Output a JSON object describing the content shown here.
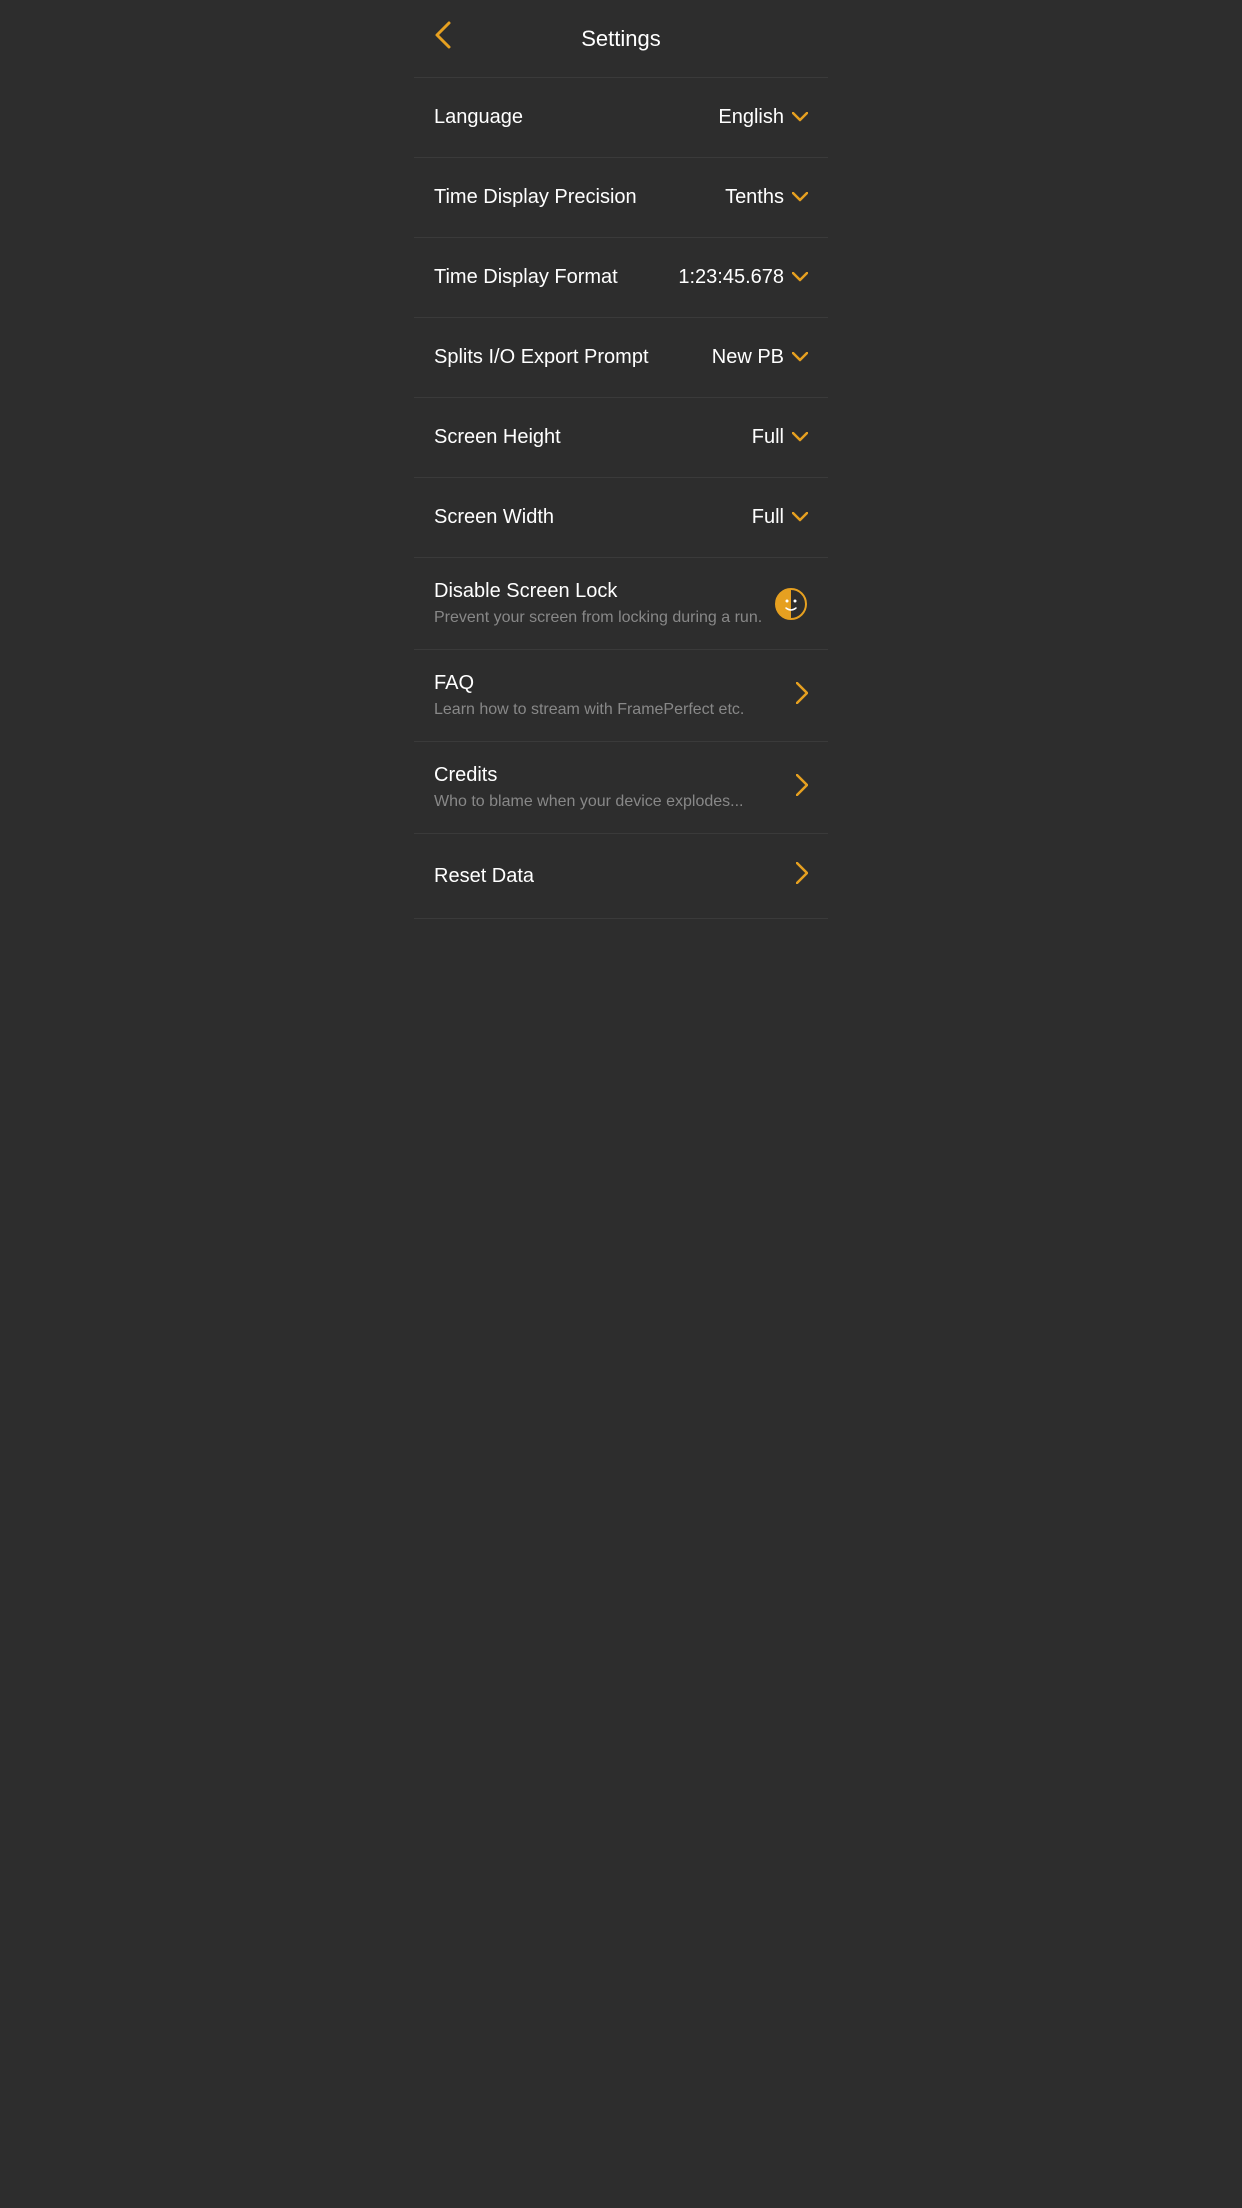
{
  "header": {
    "title": "Settings",
    "back_label": "<"
  },
  "settings": {
    "items": [
      {
        "id": "language",
        "label": "Language",
        "value": "English",
        "type": "dropdown"
      },
      {
        "id": "time-display-precision",
        "label": "Time Display Precision",
        "value": "Tenths",
        "type": "dropdown"
      },
      {
        "id": "time-display-format",
        "label": "Time Display Format",
        "value": "1:23:45.678",
        "type": "dropdown"
      },
      {
        "id": "splits-export",
        "label": "Splits I/O Export Prompt",
        "value": "New PB",
        "type": "dropdown"
      },
      {
        "id": "screen-height",
        "label": "Screen Height",
        "value": "Full",
        "type": "dropdown"
      },
      {
        "id": "screen-width",
        "label": "Screen Width",
        "value": "Full",
        "type": "dropdown"
      },
      {
        "id": "disable-screen-lock",
        "label": "Disable Screen Lock",
        "subtitle": "Prevent your screen from locking during a run.",
        "value": "",
        "type": "toggle"
      },
      {
        "id": "faq",
        "label": "FAQ",
        "subtitle": "Learn how to stream with FramePerfect etc.",
        "value": "",
        "type": "link"
      },
      {
        "id": "credits",
        "label": "Credits",
        "subtitle": "Who to blame when your device explodes...",
        "value": "",
        "type": "link"
      },
      {
        "id": "reset-data",
        "label": "Reset Data",
        "value": "",
        "type": "link-simple"
      }
    ]
  },
  "icons": {
    "chevron_down": "∨",
    "chevron_right": "›",
    "back": "‹"
  }
}
